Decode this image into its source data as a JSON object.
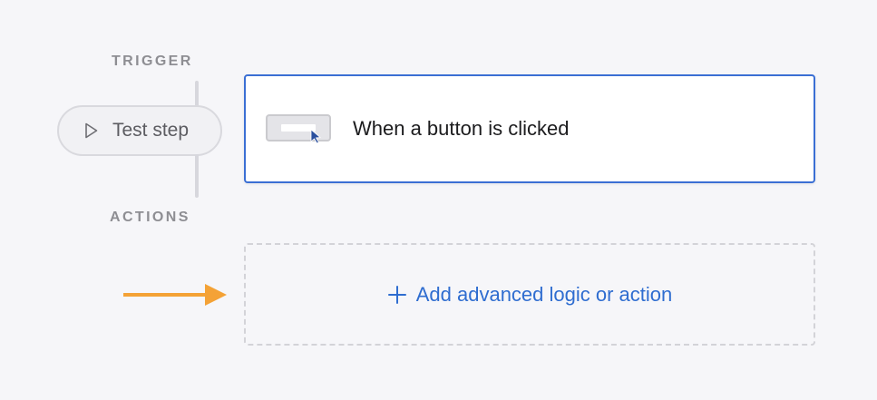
{
  "flow": {
    "trigger_label": "TRIGGER",
    "actions_label": "ACTIONS",
    "test_step_label": "Test step",
    "trigger_card": {
      "title": "When a button is clicked",
      "icon": "button-click-icon"
    },
    "add_action_label": "Add advanced logic or action"
  },
  "colors": {
    "background": "#f6f6f9",
    "accent_blue": "#3b6fd4",
    "link_blue": "#2f6dd0",
    "arrow_orange": "#f4a236",
    "label_gray": "#8e8e93"
  }
}
